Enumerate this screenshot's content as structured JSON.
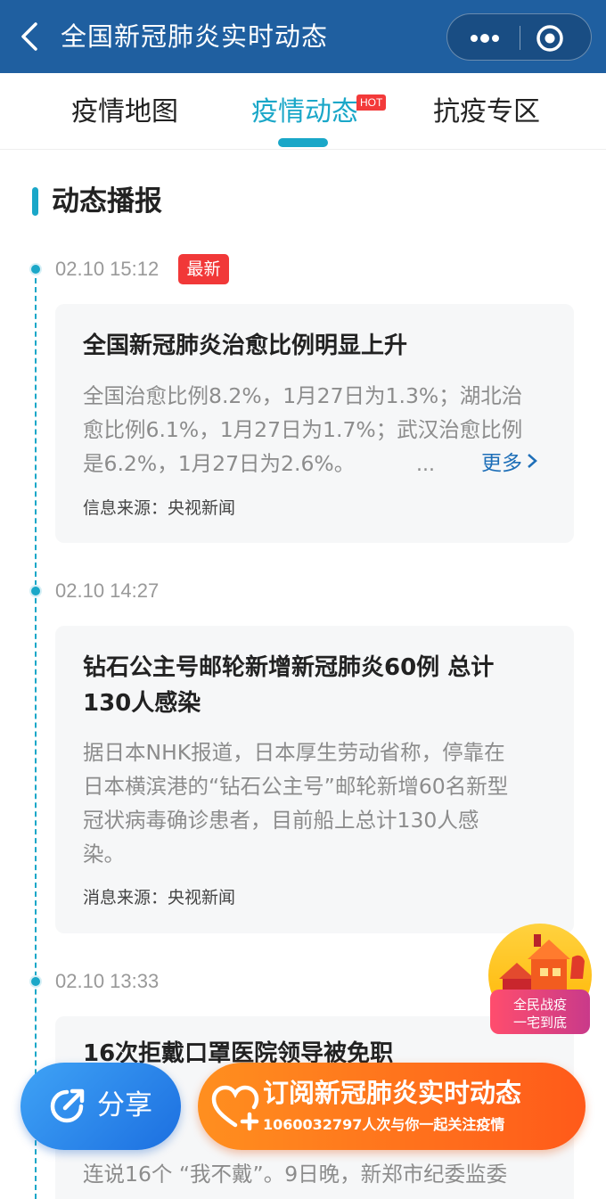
{
  "header": {
    "title": "全国新冠肺炎实时动态"
  },
  "tabs": [
    {
      "label": "疫情地图",
      "active": false
    },
    {
      "label": "疫情动态",
      "active": true,
      "badge": "HOT"
    },
    {
      "label": "抗疫专区",
      "active": false
    }
  ],
  "section": {
    "title": "动态播报"
  },
  "items": [
    {
      "time": "02.10 15:12",
      "badge": "最新",
      "title": "全国新冠肺炎治愈比例明显上升",
      "text_lines": [
        "全国治愈比例8.2%，1月27日为1.3%；湖北治",
        "愈比例6.1%，1月27日为1.7%；武汉治愈比例",
        "是6.2%，1月27日为2.6%。"
      ],
      "ellipsis": "...",
      "more": "更多",
      "source": "信息来源：央视新闻"
    },
    {
      "time": "02.10 14:27",
      "title_lines": [
        "钻石公主号邮轮新增新冠肺炎60例 总计",
        "130人感染"
      ],
      "text_lines": [
        "据日本NHK报道，日本厚生劳动省称，停靠在",
        "日本横滨港的“钻石公主号”邮轮新增60名新型",
        "冠状病毒确诊患者，目前船上总计130人感",
        "染。"
      ],
      "source": "消息来源：央视新闻"
    },
    {
      "time": "02.10 13:33",
      "title": "16次拒戴口罩医院领导被免职",
      "text_last": "连说16个 “我不戴”。9日晚，新郑市纪委监委"
    }
  ],
  "float_badge": {
    "line1": "全民战疫",
    "line2": "一宅到底"
  },
  "share": {
    "label": "分享"
  },
  "subscribe": {
    "title": "订阅新冠肺炎实时动态",
    "subtitle": "1060032797人次与你一起关注疫情"
  },
  "colors": {
    "header_bg": "#1f5fa0",
    "accent": "#1aa7c8",
    "badge_red": "#f13838",
    "link": "#1e6fb8",
    "share_blue": "#1c6fe0",
    "subscribe_orange": "#ff6a1a"
  }
}
